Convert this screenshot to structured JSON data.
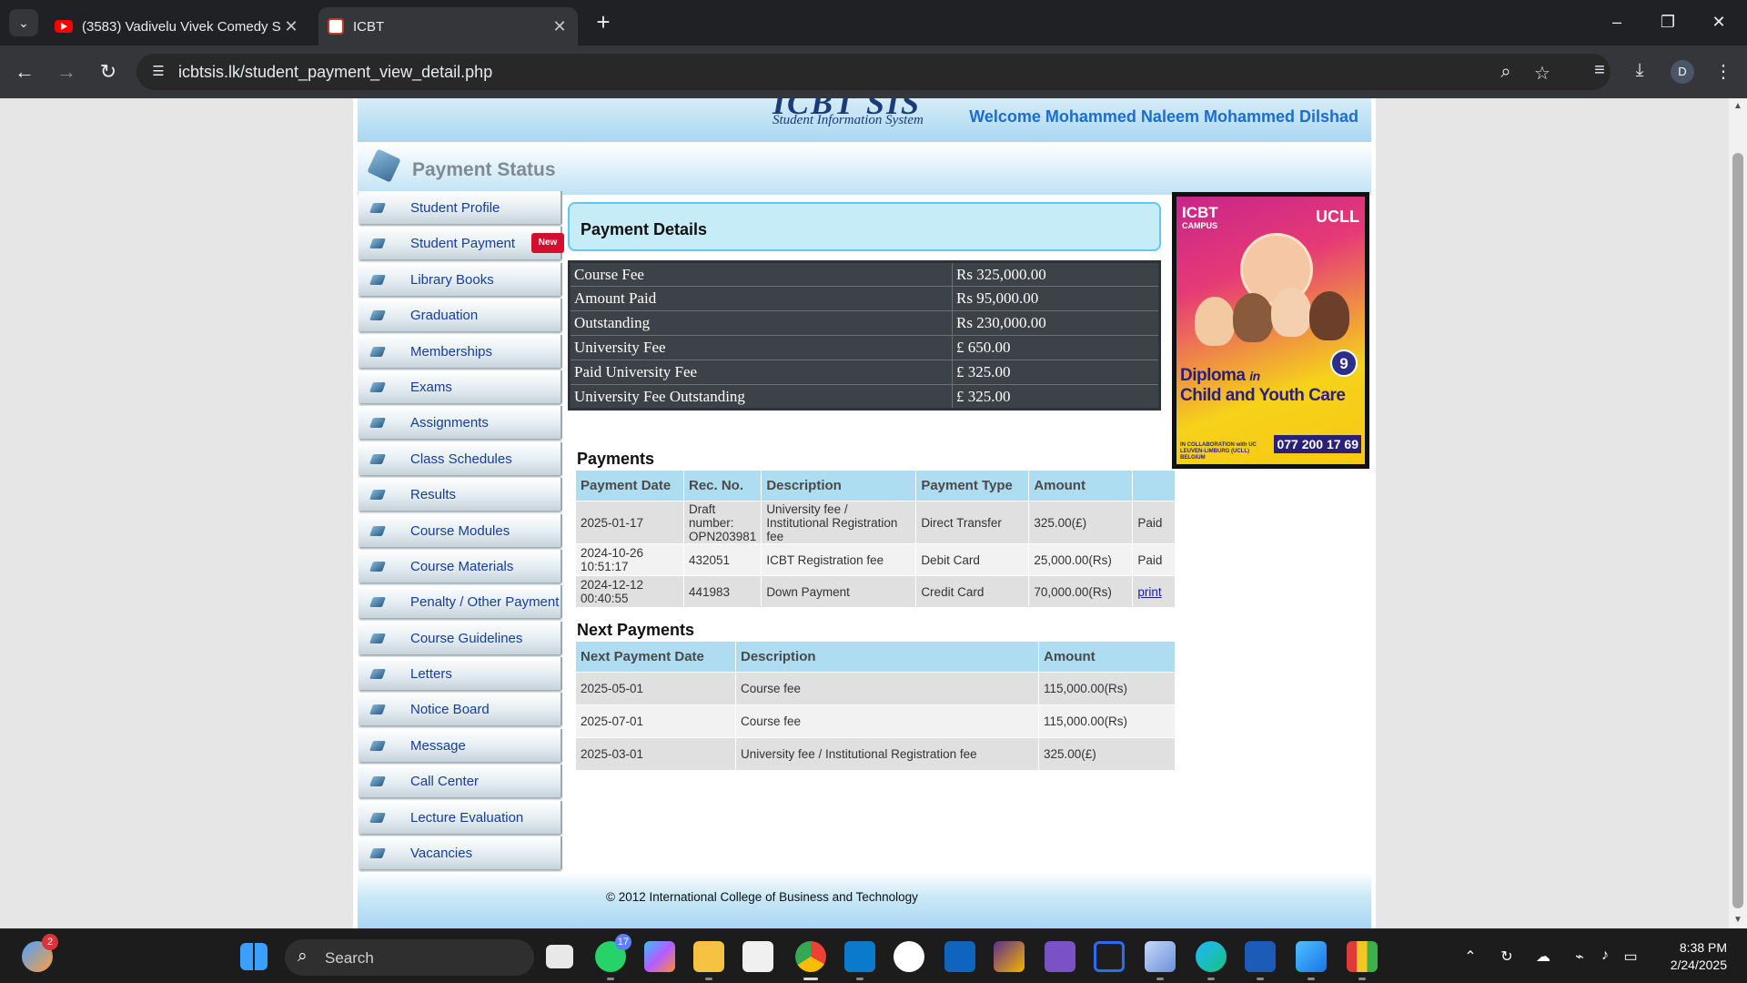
{
  "browser": {
    "tabs": [
      {
        "title": "(3583) Vadivelu Vivek Comedy S",
        "favicon": "youtube-icon",
        "active": false
      },
      {
        "title": "ICBT",
        "favicon": "icbt-icon",
        "active": true
      }
    ],
    "url": "icbtsis.lk/student_payment_view_detail.php",
    "profile_initial": "D"
  },
  "header": {
    "logo_text": "ICBT SIS",
    "logo_subtitle": "Student Information System",
    "welcome": "Welcome Mohammed Naleem Mohammed Dilshad"
  },
  "page_title": "Payment Status",
  "sidebar": {
    "items": [
      {
        "label": "Student Profile"
      },
      {
        "label": "Student Payment",
        "badge": "New"
      },
      {
        "label": "Library Books"
      },
      {
        "label": "Graduation"
      },
      {
        "label": "Memberships"
      },
      {
        "label": "Exams"
      },
      {
        "label": "Assignments"
      },
      {
        "label": "Class Schedules"
      },
      {
        "label": "Results"
      },
      {
        "label": "Course Modules"
      },
      {
        "label": "Course Materials"
      },
      {
        "label": "Penalty / Other Payment"
      },
      {
        "label": "Course Guidelines"
      },
      {
        "label": "Letters"
      },
      {
        "label": "Notice Board"
      },
      {
        "label": "Message"
      },
      {
        "label": "Call Center"
      },
      {
        "label": "Lecture Evaluation"
      },
      {
        "label": "Vacancies"
      }
    ]
  },
  "payment_details": {
    "heading": "Payment Details",
    "rows": [
      {
        "label": "Course Fee",
        "value": "Rs 325,000.00"
      },
      {
        "label": "Amount Paid",
        "value": "Rs 95,000.00"
      },
      {
        "label": "Outstanding",
        "value": "Rs 230,000.00"
      },
      {
        "label": "University Fee",
        "value": "£ 650.00"
      },
      {
        "label": "Paid University Fee",
        "value": "£ 325.00"
      },
      {
        "label": "University Fee Outstanding",
        "value": "£ 325.00"
      }
    ]
  },
  "payments": {
    "heading": "Payments",
    "columns": [
      "Payment Date",
      "Rec. No.",
      "Description",
      "Payment Type",
      "Amount",
      ""
    ],
    "rows": [
      {
        "date": "2025-01-17",
        "rec": "Draft number: OPN203981",
        "desc": "University fee / Institutional Registration fee",
        "type": "Direct Transfer",
        "amount": "325.00(£)",
        "status": "Paid"
      },
      {
        "date": "2024-10-26 10:51:17",
        "rec": "432051",
        "desc": "ICBT Registration fee",
        "type": "Debit Card",
        "amount": "25,000.00(Rs)",
        "status": "Paid"
      },
      {
        "date": "2024-12-12 00:40:55",
        "rec": "441983",
        "desc": "Down Payment",
        "type": "Credit Card",
        "amount": "70,000.00(Rs)",
        "status": "print"
      }
    ]
  },
  "next_payments": {
    "heading": "Next Payments",
    "columns": [
      "Next Payment Date",
      "Description",
      "Amount"
    ],
    "rows": [
      {
        "date": "2025-05-01",
        "desc": "Course fee",
        "amount": "115,000.00(Rs)"
      },
      {
        "date": "2025-07-01",
        "desc": "Course fee",
        "amount": "115,000.00(Rs)"
      },
      {
        "date": "2025-03-01",
        "desc": "University fee / Institutional Registration fee",
        "amount": "325.00(£)"
      }
    ]
  },
  "ad": {
    "logo_left": "ICBT",
    "logo_left_sub": "CAMPUS",
    "logo_right": "UCLL",
    "badge": "9",
    "title_line1": "Diploma",
    "title_in": "in",
    "title_line2": "Child and Youth Care",
    "collab": "IN COLLABORATION with UC LEUVEN-LIMBURG (UCLL) BELGIUM",
    "phone": "077 200 17 69"
  },
  "footer": "© 2012 International College of Business and Technology",
  "taskbar": {
    "weather_badge": "2",
    "search_placeholder": "Search",
    "whatsapp_badge": "17",
    "time": "8:38 PM",
    "date": "2/24/2025"
  },
  "colors": {
    "link_blue": "#163d99",
    "welcome_blue": "#1c6dd0",
    "header_band": "#a9d7f1",
    "new_badge": "#d0102e"
  }
}
